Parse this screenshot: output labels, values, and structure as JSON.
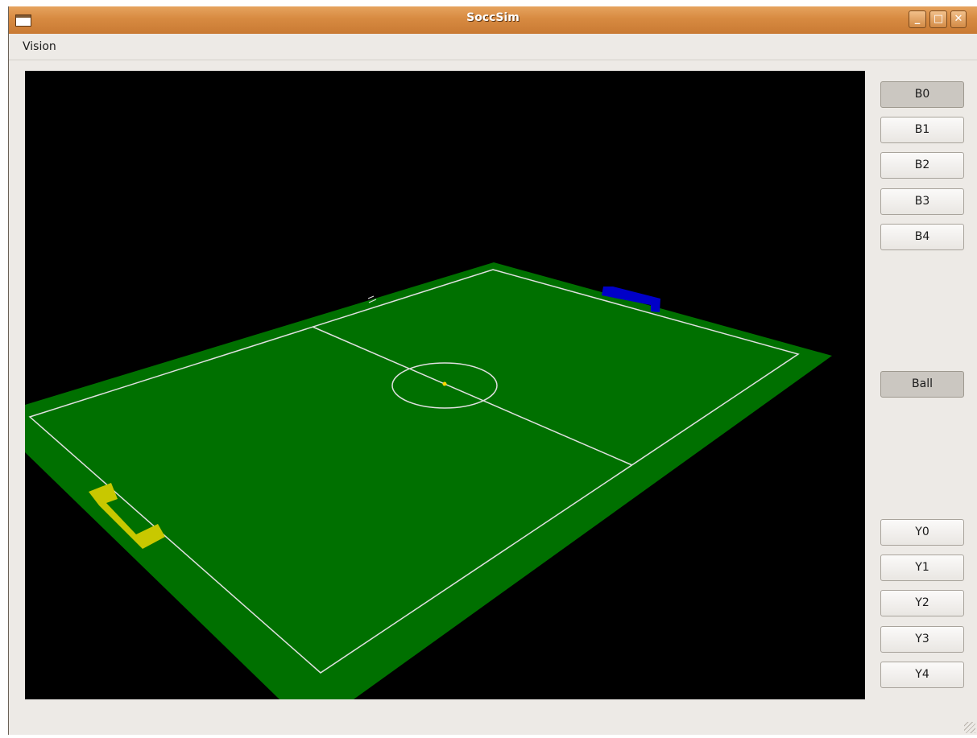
{
  "window": {
    "title": "SoccSim",
    "minimize_glyph": "_",
    "maximize_glyph": "□",
    "close_glyph": "✕"
  },
  "menu": {
    "items": [
      "Vision"
    ]
  },
  "sidebar": {
    "blue_robots": [
      "B0",
      "B1",
      "B2",
      "B3",
      "B4"
    ],
    "ball": "Ball",
    "yellow_robots": [
      "Y0",
      "Y1",
      "Y2",
      "Y3",
      "Y4"
    ]
  },
  "colors": {
    "field": "#007000",
    "field_lines": "#e0e0e0",
    "blue_goal": "#0000c8",
    "yellow_goal": "#c8c800",
    "ball": "#ffd800",
    "viewport_bg": "#000000"
  }
}
